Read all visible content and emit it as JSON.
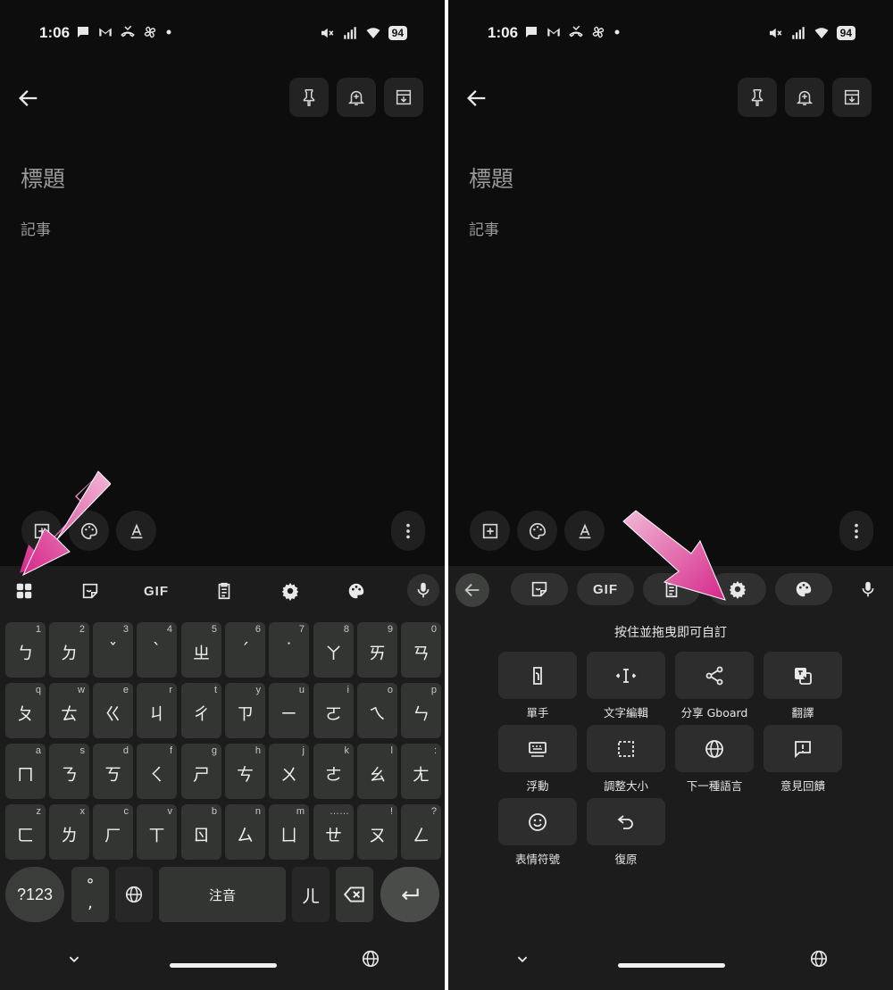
{
  "status": {
    "time": "1:06",
    "battery": "94"
  },
  "note": {
    "title_placeholder": "標題",
    "body_placeholder": "記事"
  },
  "keyboard_left": {
    "toolbar": {
      "gif_label": "GIF"
    },
    "row1": [
      {
        "hint": "1",
        "label": "ㄅ"
      },
      {
        "hint": "2",
        "label": "ㄉ"
      },
      {
        "hint": "3",
        "label": "ˇ"
      },
      {
        "hint": "4",
        "label": "ˋ"
      },
      {
        "hint": "5",
        "label": "ㄓ"
      },
      {
        "hint": "6",
        "label": "ˊ"
      },
      {
        "hint": "7",
        "label": "˙"
      },
      {
        "hint": "8",
        "label": "ㄚ"
      },
      {
        "hint": "9",
        "label": "ㄞ"
      },
      {
        "hint": "0",
        "label": "ㄢ"
      }
    ],
    "row2": [
      {
        "hint": "q",
        "label": "ㄆ"
      },
      {
        "hint": "w",
        "label": "ㄊ"
      },
      {
        "hint": "e",
        "label": "ㄍ"
      },
      {
        "hint": "r",
        "label": "ㄐ"
      },
      {
        "hint": "t",
        "label": "ㄔ"
      },
      {
        "hint": "y",
        "label": "ㄗ"
      },
      {
        "hint": "u",
        "label": "ㄧ"
      },
      {
        "hint": "i",
        "label": "ㄛ"
      },
      {
        "hint": "o",
        "label": "ㄟ"
      },
      {
        "hint": "p",
        "label": "ㄣ"
      }
    ],
    "row3": [
      {
        "hint": "a",
        "label": "ㄇ"
      },
      {
        "hint": "s",
        "label": "ㄋ"
      },
      {
        "hint": "d",
        "label": "ㄎ"
      },
      {
        "hint": "f",
        "label": "ㄑ"
      },
      {
        "hint": "g",
        "label": "ㄕ"
      },
      {
        "hint": "h",
        "label": "ㄘ"
      },
      {
        "hint": "j",
        "label": "ㄨ"
      },
      {
        "hint": "k",
        "label": "ㄜ"
      },
      {
        "hint": "l",
        "label": "ㄠ"
      },
      {
        "hint": ":",
        "label": "ㄤ"
      }
    ],
    "row4": [
      {
        "hint": "z",
        "label": "ㄈ"
      },
      {
        "hint": "x",
        "label": "ㄌ"
      },
      {
        "hint": "c",
        "label": "ㄏ"
      },
      {
        "hint": "v",
        "label": "ㄒ"
      },
      {
        "hint": "b",
        "label": "ㄖ"
      },
      {
        "hint": "n",
        "label": "ㄙ"
      },
      {
        "hint": "m",
        "label": "ㄩ"
      },
      {
        "hint": "……",
        "label": "ㄝ"
      },
      {
        "hint": "!",
        "label": "ㄡ"
      },
      {
        "hint": "?",
        "label": "ㄥ"
      }
    ],
    "bottom": {
      "symbols_label": "?123",
      "punct_top": "°",
      "punct_bottom": ",",
      "space_label": "注音",
      "er_label": "ㄦ"
    }
  },
  "keyboard_right": {
    "toolbar": {
      "gif_label": "GIF"
    },
    "hint": "按住並拖曳即可自訂",
    "items": [
      {
        "label": "單手",
        "icon": "one-hand-icon"
      },
      {
        "label": "文字編輯",
        "icon": "text-edit-icon"
      },
      {
        "label": "分享 Gboard",
        "icon": "share-icon"
      },
      {
        "label": "翻譯",
        "icon": "translate-icon"
      },
      {
        "label": "浮動",
        "icon": "floating-keyboard-icon"
      },
      {
        "label": "調整大小",
        "icon": "resize-icon"
      },
      {
        "label": "下一種語言",
        "icon": "globe-icon"
      },
      {
        "label": "意見回饋",
        "icon": "feedback-icon"
      },
      {
        "label": "表情符號",
        "icon": "emoji-icon"
      },
      {
        "label": "復原",
        "icon": "undo-icon"
      }
    ]
  },
  "colors": {
    "arrow": "#d63b8a",
    "background": "#0d0d0d",
    "keyboard": "#1b1c1b",
    "key": "#333533"
  }
}
